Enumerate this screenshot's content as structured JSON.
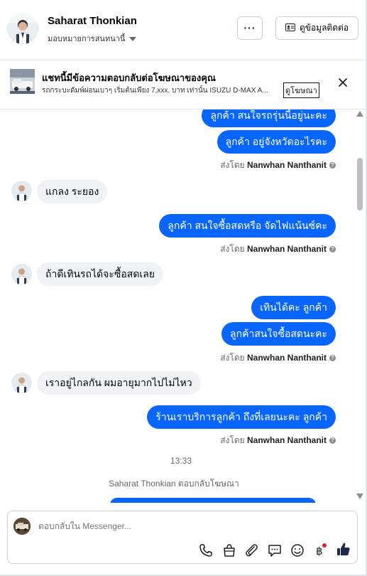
{
  "header": {
    "name": "Saharat Thonkian",
    "assign_label": "มอบหมายการสนทนานี้",
    "more_label": "···",
    "contact_label": "ดูข้อมูลติดต่อ"
  },
  "ad_banner": {
    "title": "แชทนี้มีข้อความตอบกลับต่อโฆษณาของคุณ",
    "subtitle": "รถกระบะดัมพ์ผ่อนเบาๆ เริ่มต้นเพียง 7,xxx. บาท เท่านั้น ISUZU D-MAX A...",
    "link_label": "ดูโฆษณา"
  },
  "messages": {
    "m1": "ลูกค้า สนใจรถรุ่นนี้อยู่นะคะ",
    "m2": "ลูกค้า อยู่จังหวัดอะไรคะ",
    "m3": "แกลง ระยอง",
    "m4": "ลูกค้า  สนใจซื้อสดหรือ จัดไฟแน้นซ์คะ",
    "m5": "ถ้าดีเทินรถได้จะซื้อสดเลย",
    "m6": "เทินได้คะ  ลูกค้า",
    "m7": "ลูกค้าสนใจซื้อสดนะคะ",
    "m8": "เราอยู่ไกลกัน ผมอายุมากไปไม่ไหว",
    "m9": "ร้านเราบริการลูกค้า ถึงที่เลยนะคะ  ลูกค้า"
  },
  "sent_by": {
    "prefix": "ส่งโดย",
    "agent": "Nanwhan Nanthanit"
  },
  "timestamp": "13:33",
  "replied_note": "Saharat Thonkian ตอบกลับโฆษณา",
  "composer": {
    "placeholder": "ตอบกลับใน Messenger..."
  },
  "colors": {
    "outgoing_bubble": "#0866ff",
    "incoming_bubble": "#f0f2f5",
    "accent": "#0866ff"
  }
}
